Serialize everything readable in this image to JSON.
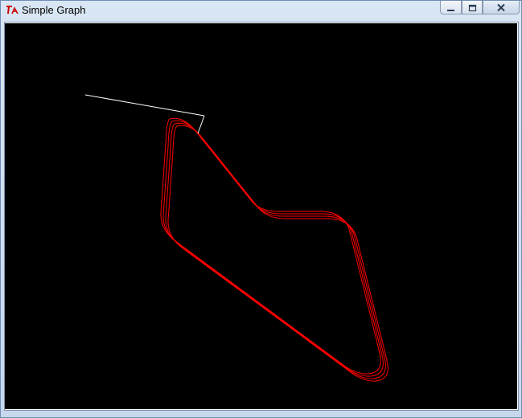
{
  "window": {
    "title": "Simple Graph",
    "app_icon": "tk-feather-icon",
    "controls": [
      "minimize-icon",
      "maximize-icon",
      "close-icon"
    ]
  },
  "canvas": {
    "background": "#000000",
    "track_color": "#ff0000",
    "line_color": "#ffffff"
  }
}
